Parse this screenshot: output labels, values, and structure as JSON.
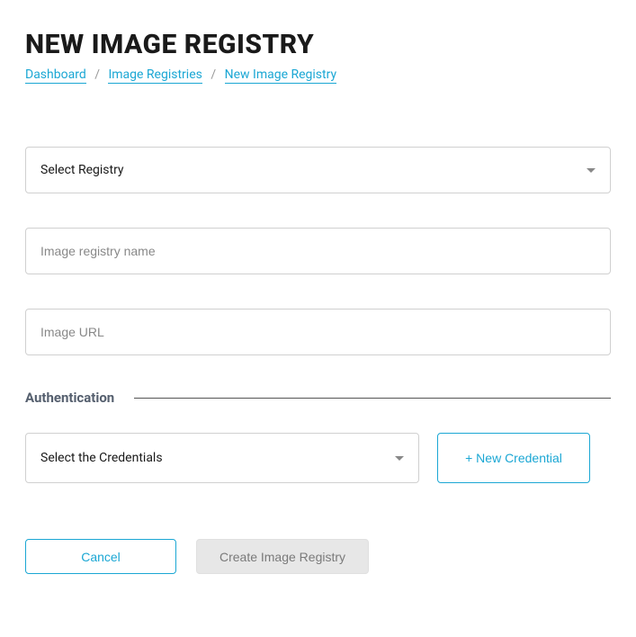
{
  "page_title": "NEW IMAGE REGISTRY",
  "breadcrumb": {
    "items": [
      {
        "label": "Dashboard"
      },
      {
        "label": "Image Registries"
      },
      {
        "label": "New Image Registry"
      }
    ],
    "separator": "/"
  },
  "form": {
    "registry_select": {
      "selected": "Select Registry"
    },
    "name_input": {
      "placeholder": "Image registry name",
      "value": ""
    },
    "url_input": {
      "placeholder": "Image URL",
      "value": ""
    }
  },
  "auth_section": {
    "title": "Authentication",
    "credentials_select": {
      "selected": "Select the Credentials"
    },
    "new_credential_label": "+ New Credential"
  },
  "actions": {
    "cancel_label": "Cancel",
    "submit_label": "Create Image Registry"
  }
}
